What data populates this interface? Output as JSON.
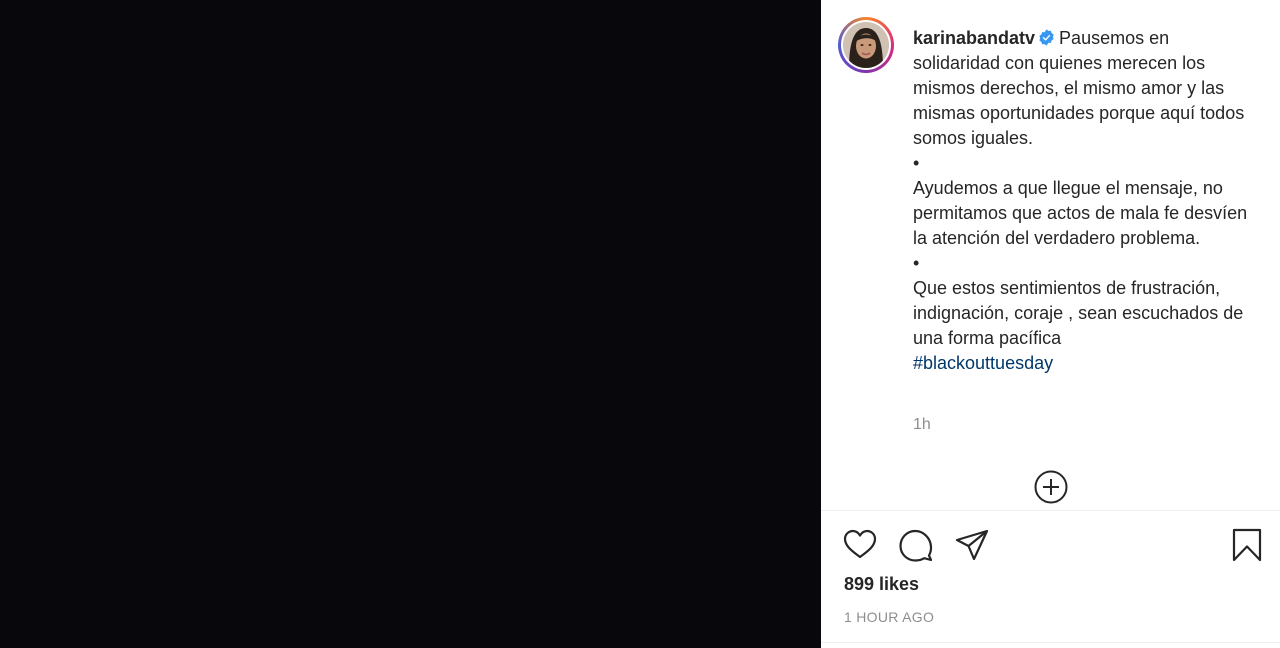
{
  "post": {
    "username": "karinabandatv",
    "caption": {
      "p1": "Pausemos en solidaridad con quienes merecen los mismos derechos, el mismo amor y las mismas oportunidades porque aquí todos somos iguales.",
      "bullet1": "•",
      "p2": "Ayudemos a que llegue el mensaje, no permitamos que actos de mala fe desvíen la atención del verdadero problema.",
      "bullet2": "•",
      "p3": "Que estos sentimientos de frustración, indignación, coraje , sean escuchados de una forma pacífica",
      "hashtag": "#blackouttuesday"
    },
    "relative_time": "1h",
    "likes": "899 likes",
    "posted_ago": "1 HOUR AGO"
  },
  "icons": {
    "verified": "verified-badge-icon",
    "more": "plus-circle-icon",
    "like": "heart-icon",
    "comment": "comment-icon",
    "share": "send-icon",
    "save": "bookmark-icon"
  },
  "colors": {
    "media_background": "#07070c",
    "text": "#262626",
    "secondary_text": "#8e8e8e",
    "hashtag": "#00376b",
    "verified_blue": "#3897f0"
  }
}
